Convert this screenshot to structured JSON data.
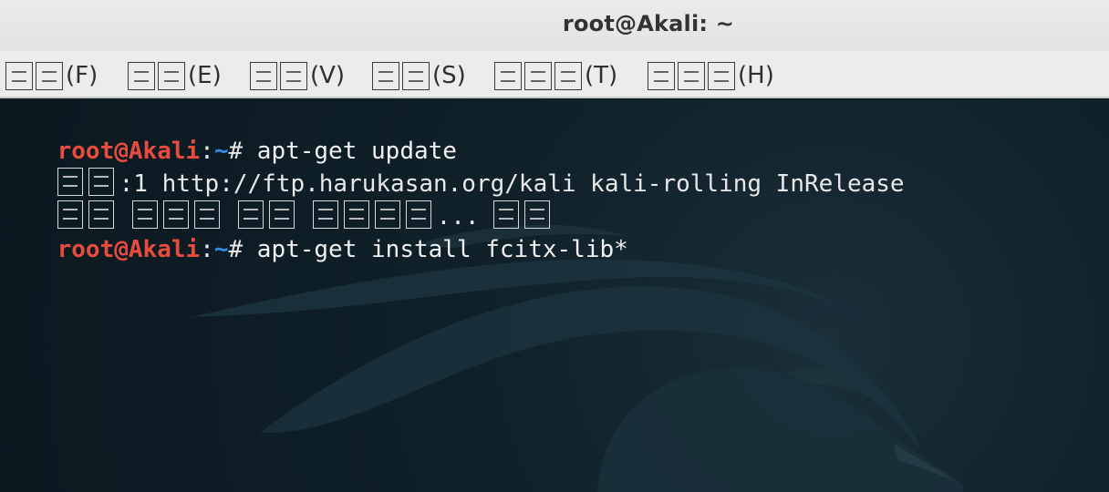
{
  "window": {
    "title": "root@Akali: ~"
  },
  "menu": [
    {
      "name": "menu-file",
      "label": "(F)",
      "glyphs": 2
    },
    {
      "name": "menu-edit",
      "label": "(E)",
      "glyphs": 2
    },
    {
      "name": "menu-view",
      "label": "(V)",
      "glyphs": 2
    },
    {
      "name": "menu-search",
      "label": "(S)",
      "glyphs": 2
    },
    {
      "name": "menu-terminal",
      "label": "(T)",
      "glyphs": 3
    },
    {
      "name": "menu-help",
      "label": "(H)",
      "glyphs": 3
    }
  ],
  "terminal": {
    "prompt_user": "root@Akali",
    "prompt_sep": ":",
    "prompt_path": "~",
    "prompt_end": "#",
    "lines": [
      {
        "type": "command",
        "text": " apt-get update"
      },
      {
        "type": "output",
        "text": ":1 http://ftp.harukasan.org/kali kali-rolling InRelease"
      },
      {
        "type": "output",
        "text": "... "
      },
      {
        "type": "command",
        "text": " apt-get install fcitx-lib*"
      }
    ]
  },
  "icons": [
    "kali-dragon-icon"
  ],
  "colors": {
    "prompt_user": "#e84c3d",
    "prompt_path": "#2f8be6",
    "terminal_bg": "#0f1c24",
    "titlebar_bg": "#ebebeb"
  }
}
